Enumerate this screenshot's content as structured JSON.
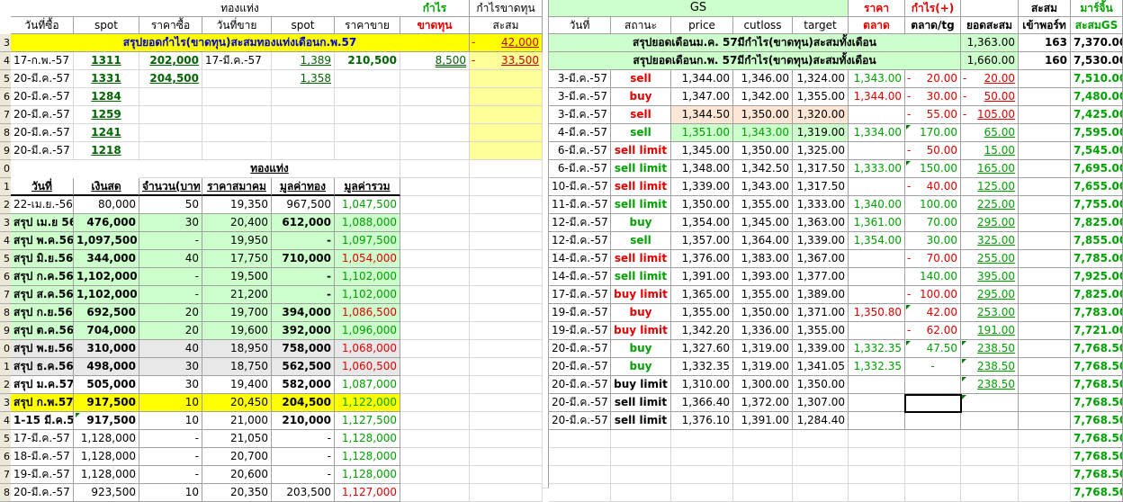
{
  "sheet": {
    "row_numbers": [
      "3",
      "4",
      "5",
      "6",
      "7",
      "8",
      "9",
      "0",
      "1",
      "2",
      "3",
      "4",
      "5",
      "6",
      "7",
      "8",
      "9",
      "0",
      "1",
      "2",
      "3",
      "4",
      "5",
      "6",
      "7",
      "8"
    ],
    "left_header": {
      "group_gold": "ทองแท่ง",
      "profit": "กำไร",
      "profit_loss_title": "กำไรขาดทุน",
      "col_buy_date": "วันที่ซื้อ",
      "col_spot": "spot",
      "col_buy_price": "ราคาซื้อ",
      "col_sell_date": "วันที่ขาย",
      "col_spot2": "spot",
      "col_sell_price": "ราคาขาย",
      "col_loss": "ขาดทุน",
      "col_accum": "สะสม"
    },
    "summary_row": {
      "label": "สรุปยอดกำไร(ขาดทุน)สะสมทองแท่งเดือนก.พ.57",
      "accum": "42,000"
    },
    "trade_rows": [
      {
        "buy_date": "17-ก.พ.-57",
        "spot": "1311",
        "buy_price": "202,000",
        "sell_date": "17-มี.ค.-57",
        "spot2": "1,389",
        "sell_price": "210,500",
        "profit": "8,500",
        "accum": "33,500"
      },
      {
        "buy_date": "20-มี.ค.-57",
        "spot": "1331",
        "buy_price": "204,500",
        "sell_date": "",
        "spot2": "1,358",
        "sell_price": "",
        "profit": "",
        "accum": ""
      },
      {
        "buy_date": "20-มี.ค.-57",
        "spot": "1284",
        "buy_price": "",
        "sell_date": "",
        "spot2": "",
        "sell_price": "",
        "profit": "",
        "accum": ""
      },
      {
        "buy_date": "20-มี.ค.-57",
        "spot": "1259",
        "buy_price": "",
        "sell_date": "",
        "spot2": "",
        "sell_price": "",
        "profit": "",
        "accum": ""
      },
      {
        "buy_date": "20-มี.ค.-57",
        "spot": "1241",
        "buy_price": "",
        "sell_date": "",
        "spot2": "",
        "sell_price": "",
        "profit": "",
        "accum": ""
      },
      {
        "buy_date": "20-มี.ค.-57",
        "spot": "1218",
        "buy_price": "",
        "sell_date": "",
        "spot2": "",
        "sell_price": "",
        "profit": "",
        "accum": ""
      }
    ],
    "bar_header": "ทองแท่ง",
    "summary_headers": {
      "date": "วันที่",
      "cash": "เงินสด",
      "qty": "จำนวน(บาท",
      "assoc_price": "ราคาสมาคม",
      "gold_value": "มูลค่าทอง",
      "total_value": "มูลค่ารวม"
    },
    "summary_rows": [
      {
        "date": "22-เม.ย.-56",
        "cash": "80,000",
        "qty": "50",
        "price": "19,350",
        "gold": "967,500",
        "total": "1,047,500",
        "bg": "",
        "total_color": "black",
        "bold": false
      },
      {
        "date": "สรุป เม.ย 56",
        "cash": "476,000",
        "qty": "30",
        "price": "20,400",
        "gold": "612,000",
        "total": "1,088,000",
        "bg": "lgr",
        "total_color": "green",
        "bold": true
      },
      {
        "date": "สรุป พ.ค.56",
        "cash": "1,097,500",
        "qty": "-",
        "price": "19,950",
        "gold": "-",
        "total": "1,097,500",
        "bg": "lgr",
        "total_color": "green",
        "bold": true
      },
      {
        "date": "สรุป มิ.ย.56",
        "cash": "344,000",
        "qty": "40",
        "price": "17,750",
        "gold": "710,000",
        "total": "1,054,000",
        "bg": "lgr",
        "total_color": "red",
        "bold": true
      },
      {
        "date": "สรุป ก.ค.56",
        "cash": "1,102,000",
        "qty": "-",
        "price": "19,500",
        "gold": "-",
        "total": "1,102,000",
        "bg": "lgr",
        "total_color": "green",
        "bold": true
      },
      {
        "date": "สรุป ส.ค.56",
        "cash": "1,102,000",
        "qty": "-",
        "price": "21,200",
        "gold": "-",
        "total": "1,102,000",
        "bg": "lgr",
        "total_color": "green",
        "bold": true
      },
      {
        "date": "สรุป ก.ย.56",
        "cash": "692,500",
        "qty": "20",
        "price": "19,700",
        "gold": "394,000",
        "total": "1,086,500",
        "bg": "lgr",
        "total_color": "red",
        "bold": true
      },
      {
        "date": "สรุป ต.ค.56",
        "cash": "704,000",
        "qty": "20",
        "price": "19,600",
        "gold": "392,000",
        "total": "1,096,000",
        "bg": "lgr",
        "total_color": "green",
        "bold": true
      },
      {
        "date": "สรุป พ.ย.56",
        "cash": "310,000",
        "qty": "40",
        "price": "18,950",
        "gold": "758,000",
        "total": "1,068,000",
        "bg": "gry",
        "total_color": "red",
        "bold": true
      },
      {
        "date": "สรุป ธ.ค.56",
        "cash": "498,000",
        "qty": "30",
        "price": "18,750",
        "gold": "562,500",
        "total": "1,060,500",
        "bg": "gry",
        "total_color": "red",
        "bold": true
      },
      {
        "date": "สรุป ม.ค.57",
        "cash": "505,000",
        "qty": "30",
        "price": "19,400",
        "gold": "582,000",
        "total": "1,087,000",
        "bg": "",
        "total_color": "green",
        "bold": true
      },
      {
        "date": "สรุป ก.พ.57",
        "cash": "917,500",
        "qty": "10",
        "price": "20,450",
        "gold": "204,500",
        "total": "1,122,000",
        "bg": "yel",
        "total_color": "green",
        "bold": true
      },
      {
        "date": "1-15 มี.ค.57",
        "cash": "917,500",
        "qty": "10",
        "price": "21,000",
        "gold": "210,000",
        "total": "1,127,500",
        "bg": "",
        "total_color": "green",
        "bold": true
      },
      {
        "date": "17-มี.ค.-57",
        "cash": "1,128,000",
        "qty": "-",
        "price": "21,050",
        "gold": "-",
        "total": "1,128,000",
        "bg": "",
        "total_color": "green",
        "bold": false
      },
      {
        "date": "18-มี.ค.-57",
        "cash": "1,128,000",
        "qty": "-",
        "price": "20,700",
        "gold": "-",
        "total": "1,128,000",
        "bg": "",
        "total_color": "green",
        "bold": false
      },
      {
        "date": "19-มี.ค.-57",
        "cash": "1,128,000",
        "qty": "-",
        "price": "20,600",
        "gold": "-",
        "total": "1,128,000",
        "bg": "",
        "total_color": "green",
        "bold": false
      },
      {
        "date": "20-มี.ค.-57",
        "cash": "923,500",
        "qty": "10",
        "price": "20,350",
        "gold": "203,500",
        "total": "1,127,000",
        "bg": "",
        "total_color": "red",
        "bold": false
      }
    ],
    "gs_header": {
      "title": "GS",
      "price_top": "ราคา",
      "profit_top": "กำไร(+)",
      "accum_top": "สะสม",
      "margin_top": "มาร์จิ้น",
      "date": "วันที่",
      "status": "สถานะ",
      "price": "price",
      "cutloss": "cutloss",
      "target": "target",
      "market": "ตลาด",
      "market_tg": "ตลาด/tg",
      "total_accum": "ยอดสะสม",
      "port": "เข้าพอร์ท",
      "gs_accum": "สะสมGS"
    },
    "gs_summary": [
      {
        "label": "สรุปยอดเดือนม.ค. 57มีกำไร(ขาดทุน)สะสมทั้งเดือน",
        "accum": "1,363.00",
        "port": "163",
        "margin": "7,370.00"
      },
      {
        "label": "สรุปยอดเดือนก.พ. 57มีกำไร(ขาดทุน)สะสมทั้งเดือน",
        "accum": "1,660.00",
        "port": "160",
        "margin": "7,530.00"
      }
    ],
    "gs_rows": [
      {
        "date": "3-มี.ค.-57",
        "status": "sell",
        "status_color": "red",
        "price": "1,344.00",
        "cutloss": "1,346.00",
        "target": "1,324.00",
        "market": "1,343.00",
        "market_color": "green",
        "mtg": "20.00",
        "mtg_color": "red",
        "mtg_dash": true,
        "accum": "20.00",
        "accum_color": "red",
        "accum_dash": true,
        "margin": "7,510.00",
        "hl": ""
      },
      {
        "date": "3-มี.ค.-57",
        "status": "buy",
        "status_color": "red",
        "price": "1,347.00",
        "cutloss": "1,342.00",
        "target": "1,355.00",
        "market": "1,344.00",
        "market_color": "red",
        "mtg": "30.00",
        "mtg_color": "red",
        "mtg_dash": true,
        "accum": "50.00",
        "accum_color": "red",
        "accum_dash": true,
        "margin": "7,480.00",
        "hl": ""
      },
      {
        "date": "3-มี.ค.-57",
        "status": "sell",
        "status_color": "red",
        "price": "1,344.50",
        "cutloss": "1,350.00",
        "target": "1,320.00",
        "market": "",
        "market_color": "green",
        "mtg": "55.00",
        "mtg_color": "red",
        "mtg_dash": true,
        "accum": "105.00",
        "accum_color": "red",
        "accum_dash": true,
        "margin": "7,425.00",
        "hl": "pnk"
      },
      {
        "date": "4-มี.ค.-57",
        "status": "sell",
        "status_color": "green",
        "price": "1,351.00",
        "cutloss": "1,343.00",
        "target": "1,319.00",
        "market": "1,334.00",
        "market_color": "green",
        "mtg": "170.00",
        "mtg_color": "green",
        "mtg_dash": false,
        "accum": "65.00",
        "accum_color": "green",
        "accum_dash": false,
        "margin": "7,595.00",
        "hl": "lgr"
      },
      {
        "date": "6-มี.ค.-57",
        "status": "sell limit",
        "status_color": "red",
        "price": "1,345.00",
        "cutloss": "1,350.00",
        "target": "1,325.00",
        "market": "",
        "market_color": "green",
        "mtg": "50.00",
        "mtg_color": "red",
        "mtg_dash": true,
        "accum": "15.00",
        "accum_color": "green",
        "accum_dash": false,
        "margin": "7,545.00",
        "hl": ""
      },
      {
        "date": "6-มี.ค.-57",
        "status": "sell limit",
        "status_color": "green",
        "price": "1,348.00",
        "cutloss": "1,342.50",
        "target": "1,317.50",
        "market": "1,333.00",
        "market_color": "green",
        "mtg": "150.00",
        "mtg_color": "green",
        "mtg_dash": false,
        "accum": "165.00",
        "accum_color": "green",
        "accum_dash": false,
        "margin": "7,695.00",
        "hl": ""
      },
      {
        "date": "10-มี.ค.-57",
        "status": "sell limit",
        "status_color": "red",
        "price": "1,339.00",
        "cutloss": "1,343.00",
        "target": "1,317.50",
        "market": "",
        "market_color": "green",
        "mtg": "40.00",
        "mtg_color": "red",
        "mtg_dash": true,
        "accum": "125.00",
        "accum_color": "green",
        "accum_dash": false,
        "margin": "7,655.00",
        "hl": ""
      },
      {
        "date": "11-มี.ค.-57",
        "status": "sell limit",
        "status_color": "green",
        "price": "1,350.00",
        "cutloss": "1,355.00",
        "target": "1,333.00",
        "market": "1,340.00",
        "market_color": "green",
        "mtg": "100.00",
        "mtg_color": "green",
        "mtg_dash": false,
        "accum": "225.00",
        "accum_color": "green",
        "accum_dash": false,
        "margin": "7,755.00",
        "hl": ""
      },
      {
        "date": "12-มี.ค.-57",
        "status": "buy",
        "status_color": "green",
        "price": "1,354.00",
        "cutloss": "1,345.00",
        "target": "1,363.00",
        "market": "1,361.00",
        "market_color": "green",
        "mtg": "70.00",
        "mtg_color": "green",
        "mtg_dash": false,
        "accum": "295.00",
        "accum_color": "green",
        "accum_dash": false,
        "margin": "7,825.00",
        "hl": ""
      },
      {
        "date": "12-มี.ค.-57",
        "status": "sell",
        "status_color": "green",
        "price": "1,357.00",
        "cutloss": "1,364.00",
        "target": "1,339.00",
        "market": "1,354.00",
        "market_color": "green",
        "mtg": "30.00",
        "mtg_color": "green",
        "mtg_dash": false,
        "accum": "325.00",
        "accum_color": "green",
        "accum_dash": false,
        "margin": "7,855.00",
        "hl": ""
      },
      {
        "date": "14-มี.ค.-57",
        "status": "sell limit",
        "status_color": "red",
        "price": "1,376.00",
        "cutloss": "1,383.00",
        "target": "1,367.00",
        "market": "",
        "market_color": "green",
        "mtg": "70.00",
        "mtg_color": "red",
        "mtg_dash": true,
        "accum": "255.00",
        "accum_color": "green",
        "accum_dash": false,
        "margin": "7,785.00",
        "hl": ""
      },
      {
        "date": "14-มี.ค.-57",
        "status": "sell limit",
        "status_color": "green",
        "price": "1,391.00",
        "cutloss": "1,393.00",
        "target": "1,377.00",
        "market": "",
        "market_color": "green",
        "mtg": "140.00",
        "mtg_color": "green",
        "mtg_dash": false,
        "accum": "395.00",
        "accum_color": "green",
        "accum_dash": false,
        "margin": "7,925.00",
        "hl": ""
      },
      {
        "date": "17-มี.ค.-57",
        "status": "buy limit",
        "status_color": "red",
        "price": "1,365.00",
        "cutloss": "1,355.00",
        "target": "1,389.00",
        "market": "",
        "market_color": "green",
        "mtg": "100.00",
        "mtg_color": "red",
        "mtg_dash": true,
        "accum": "295.00",
        "accum_color": "green",
        "accum_dash": false,
        "margin": "7,825.00",
        "hl": ""
      },
      {
        "date": "19-มี.ค.-57",
        "status": "buy",
        "status_color": "red",
        "price": "1,355.00",
        "cutloss": "1,350.00",
        "target": "1,371.00",
        "market": "1,350.80",
        "market_color": "red",
        "mtg": "42.00",
        "mtg_color": "red",
        "mtg_dash": false,
        "accum": "253.00",
        "accum_color": "green",
        "accum_dash": false,
        "margin": "7,783.00",
        "hl": ""
      },
      {
        "date": "19-มี.ค.-57",
        "status": "buy limit",
        "status_color": "red",
        "price": "1,342.20",
        "cutloss": "1,336.00",
        "target": "1,355.00",
        "market": "",
        "market_color": "green",
        "mtg": "62.00",
        "mtg_color": "red",
        "mtg_dash": true,
        "accum": "191.00",
        "accum_color": "green",
        "accum_dash": false,
        "margin": "7,721.00",
        "hl": ""
      },
      {
        "date": "20-มี.ค.-57",
        "status": "buy",
        "status_color": "green",
        "price": "1,327.60",
        "cutloss": "1,319.00",
        "target": "1,339.00",
        "market": "1,332.35",
        "market_color": "green",
        "mtg": "47.50",
        "mtg_color": "green",
        "mtg_dash": false,
        "accum": "238.50",
        "accum_color": "green",
        "accum_dash": false,
        "margin": "7,768.50",
        "hl": ""
      },
      {
        "date": "20-มี.ค.-57",
        "status": "buy",
        "status_color": "green",
        "price": "1,332.35",
        "cutloss": "1,319.00",
        "target": "1,341.05",
        "market": "1,332.35",
        "market_color": "green",
        "mtg": "-",
        "mtg_color": "green",
        "mtg_dash": false,
        "accum": "238.50",
        "accum_color": "green",
        "accum_dash": false,
        "margin": "7,768.50",
        "hl": ""
      },
      {
        "date": "20-มี.ค.-57",
        "status": "buy limit",
        "status_color": "black",
        "price": "1,310.00",
        "cutloss": "1,300.00",
        "target": "1,350.00",
        "market": "",
        "market_color": "green",
        "mtg": "",
        "mtg_color": "green",
        "mtg_dash": false,
        "accum": "238.50",
        "accum_color": "green",
        "accum_dash": false,
        "margin": "7,768.50",
        "hl": ""
      },
      {
        "date": "20-มี.ค.-57",
        "status": "sell limit",
        "status_color": "black",
        "price": "1,366.40",
        "cutloss": "1,372.00",
        "target": "1,307.00",
        "market": "",
        "market_color": "green",
        "mtg": "",
        "mtg_color": "green",
        "mtg_dash": false,
        "accum": "",
        "accum_color": "green",
        "accum_dash": false,
        "margin": "7,768.50",
        "hl": ""
      },
      {
        "date": "20-มี.ค.-57",
        "status": "sell limit",
        "status_color": "black",
        "price": "1,376.10",
        "cutloss": "1,391.00",
        "target": "1,284.40",
        "market": "",
        "market_color": "green",
        "mtg": "",
        "mtg_color": "green",
        "mtg_dash": false,
        "accum": "",
        "accum_color": "green",
        "accum_dash": false,
        "margin": "7,768.50",
        "hl": ""
      }
    ],
    "extra_margins": [
      "7,768.50",
      "7,768.50",
      "7,768.50",
      "7,768.50"
    ],
    "dash": "-"
  }
}
